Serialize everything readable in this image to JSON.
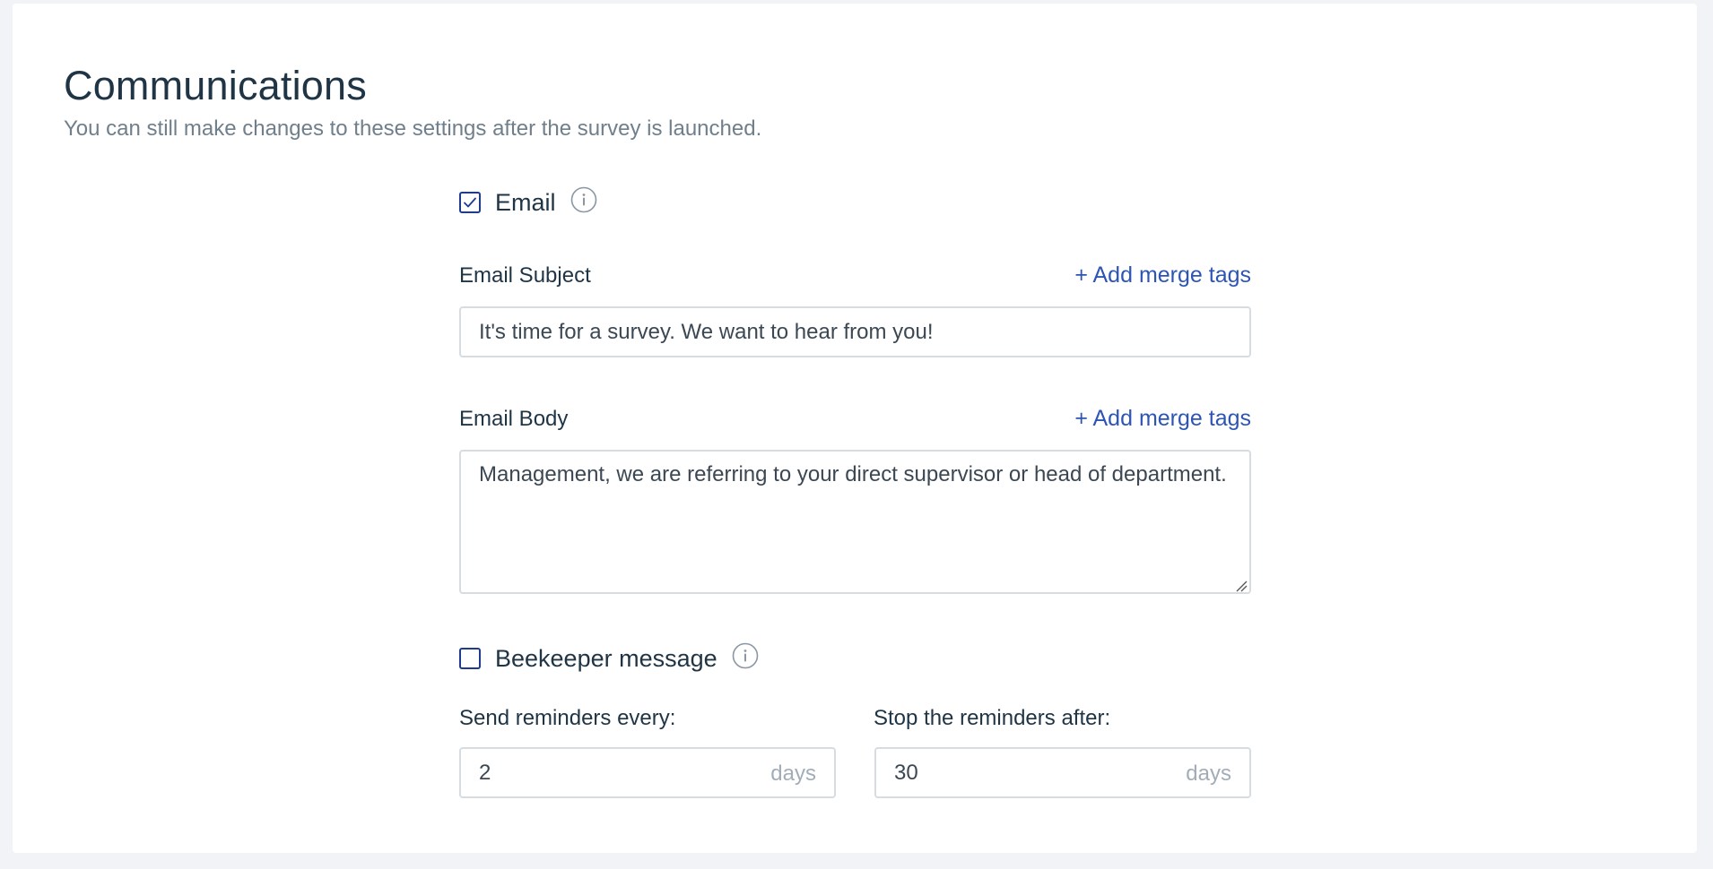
{
  "section": {
    "title": "Communications",
    "subtitle": "You can still make changes to these settings after the survey is launched."
  },
  "email": {
    "label": "Email",
    "checked": true
  },
  "email_subject": {
    "label": "Email Subject",
    "merge_link": "+ Add merge tags",
    "value": "It's time for a survey. We want to hear from you!"
  },
  "email_body": {
    "label": "Email Body",
    "merge_link": "+ Add merge tags",
    "value": "Management, we are referring to your direct supervisor or head of department."
  },
  "beekeeper": {
    "label": "Beekeeper message",
    "checked": false
  },
  "reminders": {
    "every_label": "Send reminders every:",
    "every_value": "2",
    "every_unit": "days",
    "stop_label": "Stop the reminders after:",
    "stop_value": "30",
    "stop_unit": "days"
  },
  "icons": {
    "checkbox_checked": "checkmark-icon",
    "info": "info-icon",
    "resize": "resize-grip-icon"
  },
  "colors": {
    "accent": "#2d55b5",
    "checkbox_border": "#1f3b8f",
    "heading": "#1f3445",
    "muted": "#6f7f8b",
    "unit": "#a2adb8",
    "page_bg": "#f1f3f7"
  }
}
